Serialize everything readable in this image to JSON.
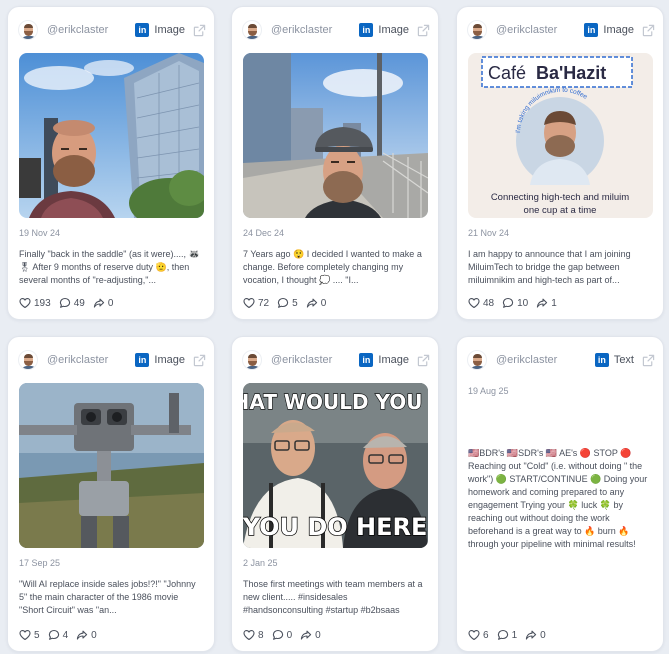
{
  "cards": [
    {
      "handle": "@erikclaster",
      "type": "Image",
      "date": "19 Nov 24",
      "text": "Finally \"back in the saddle\" (as it were)...., 🦝 🎖 After 9 months of reserve duty 🫡, then several months of \"re-adjusting,\"...",
      "likes": "193",
      "comments": "49",
      "shares": "0"
    },
    {
      "handle": "@erikclaster",
      "type": "Image",
      "date": "24 Dec 24",
      "text": "7 Years ago 😲 I decided I wanted to make a change. Before completely changing my vocation, I thought 💭 .... \"I...",
      "likes": "72",
      "comments": "5",
      "shares": "0"
    },
    {
      "handle": "@erikclaster",
      "type": "Image",
      "date": "21 Nov 24",
      "text": "I am happy to announce that I am joining MiluimTech to bridge the gap between miluimnikim and high-tech as part of...",
      "likes": "48",
      "comments": "10",
      "shares": "1",
      "image": {
        "title_1": "Café",
        "title_2": "Ba'Hazit",
        "arc_text": "I'm taking miluimnikim to coffee",
        "line_1": "Connecting high-tech and miluim",
        "line_2": "one cup at a time"
      }
    },
    {
      "handle": "@erikclaster",
      "type": "Image",
      "date": "17 Sep 25",
      "text": "\"Will AI replace inside sales jobs!?!\" \"Johnny 5\" the main character of the 1986 movie \"Short Circuit\" was \"an...",
      "likes": "5",
      "comments": "4",
      "shares": "0"
    },
    {
      "handle": "@erikclaster",
      "type": "Image",
      "date": "2 Jan 25",
      "text": "Those first meetings with team members at a new client..... #insidesales #handsonconsulting #startup #b2bsaas",
      "likes": "8",
      "comments": "0",
      "shares": "0",
      "image": {
        "top_text": "WHAT WOULD YOU SA",
        "bottom_text": "YOU DO HERE"
      }
    },
    {
      "handle": "@erikclaster",
      "type": "Text",
      "date": "19 Aug 25",
      "text": "🇺🇸BDR's 🇺🇸SDR's 🇺🇸 AE's 🔴 STOP 🔴 Reaching out \"Cold\" (i.e. without doing \" the work\") 🟢 START/CONTINUE 🟢 Doing your homework and coming prepared to any engagement Trying your 🍀 luck 🍀 by reaching out without doing the work beforehand is a great way to 🔥 burn 🔥 through your pipeline with minimal results!",
      "likes": "6",
      "comments": "1",
      "shares": "0"
    }
  ],
  "icons": {
    "platform": "linkedin-icon",
    "open": "external-link-icon",
    "likes": "heart-icon",
    "comments": "comment-icon",
    "shares": "share-icon"
  },
  "colors": {
    "linkedin": "#0a66c2",
    "background": "#e9edf3",
    "card": "#ffffff",
    "muted_text": "#8c93a1"
  }
}
